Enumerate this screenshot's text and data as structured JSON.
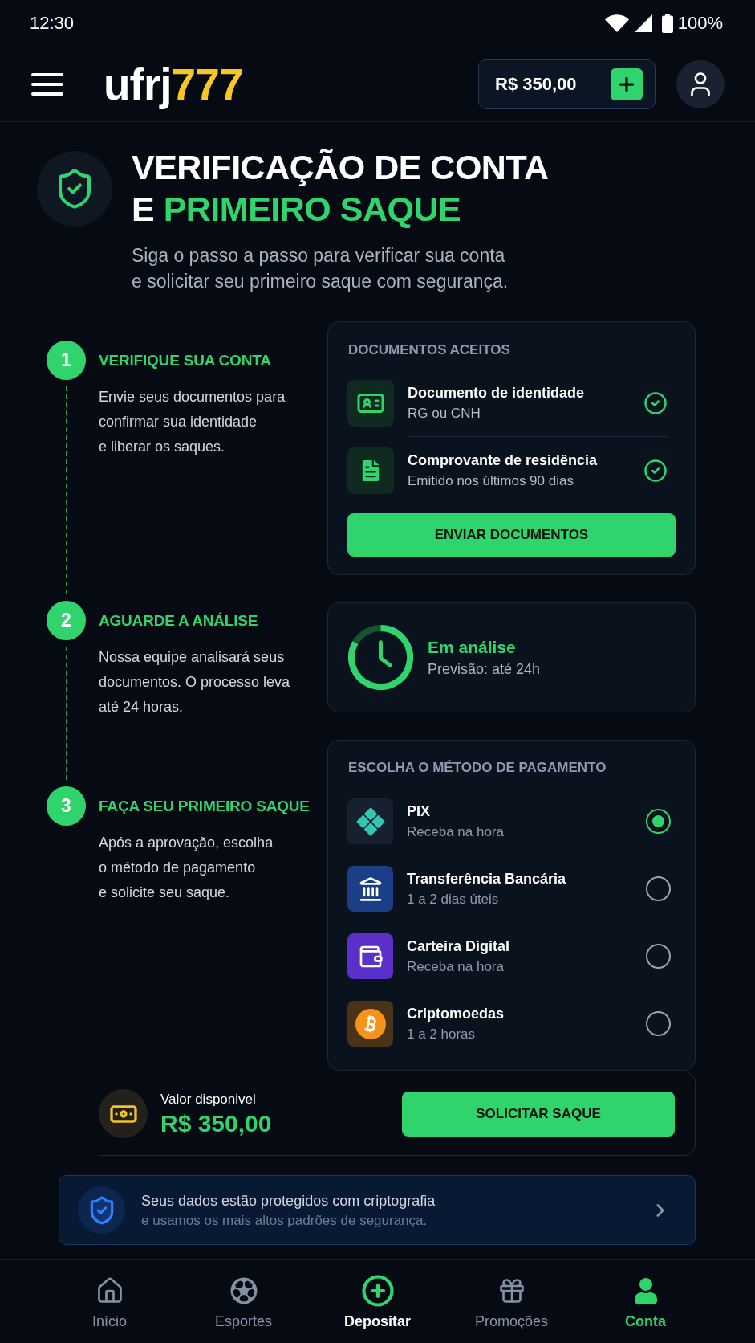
{
  "status_bar": {
    "time": "12:30",
    "battery": "100%"
  },
  "header": {
    "logo": {
      "name": "ufrj",
      "accent": "777"
    },
    "balance": "R$ 350,00"
  },
  "hero": {
    "title": "VERIFICAÇÃO DE CONTA\nE",
    "title_highlight": "PRIMEIRO SAQUE",
    "subtitle": "Siga o passo a passo para verificar sua conta\ne solicitar seu primeiro saque com segurança."
  },
  "steps": [
    {
      "number": "1",
      "title": "VERIFIQUE SUA CONTA",
      "description": "Envie seus documentos para\nconfirmar sua identidade\ne liberar os saques."
    },
    {
      "number": "2",
      "title": "AGUARDE A ANÁLISE",
      "description": "Nossa equipe analisará seus\ndocumentos. O processo leva\naté 24 horas."
    },
    {
      "number": "3",
      "title": "FAÇA SEU PRIMEIRO SAQUE",
      "description": "Após a aprovação, escolha\no método de pagamento\ne solicite seu saque."
    }
  ],
  "documents": {
    "heading": "DOCUMENTOS ACEITOS",
    "items": [
      {
        "kind": "id",
        "name": "Documento de identidade",
        "detail": "RG ou CNH",
        "checked": true
      },
      {
        "kind": "file",
        "name": "Comprovante de residência",
        "detail": "Emitido nos últimos 90 dias",
        "checked": true
      }
    ],
    "button": "ENVIAR DOCUMENTOS"
  },
  "review": {
    "status": "Em análise",
    "eta": "Previsão: até 24h"
  },
  "payment": {
    "heading": "ESCOLHA O MÉTODO DE PAGAMENTO",
    "methods": [
      {
        "kind": "pix",
        "name": "PIX",
        "detail": "Receba na hora",
        "selected": true
      },
      {
        "kind": "bank",
        "name": "Transferência Bancária",
        "detail": "1 a 2 dias úteis",
        "selected": false
      },
      {
        "kind": "wallet",
        "name": "Carteira Digital",
        "detail": "Receba na hora",
        "selected": false
      },
      {
        "kind": "crypto",
        "name": "Criptomoedas",
        "detail": "1 a 2 horas",
        "selected": false
      }
    ]
  },
  "withdraw": {
    "label": "Valor disponivel",
    "amount": "R$ 350,00",
    "button": "SOLICITAR SAQUE"
  },
  "security": {
    "title": "Seus dados estão protegidos com criptografia",
    "subtitle": "e usamos os mais altos padrões de segurança."
  },
  "nav": {
    "items": [
      {
        "kind": "tab",
        "label": "Início",
        "selected": false
      },
      {
        "kind": "tab",
        "label": "Esportes",
        "selected": false
      },
      {
        "kind": "action",
        "label": "Depositar",
        "selected": false
      },
      {
        "kind": "tab",
        "label": "Promoções",
        "selected": false
      },
      {
        "kind": "tab",
        "label": "Conta",
        "selected": true
      }
    ]
  }
}
